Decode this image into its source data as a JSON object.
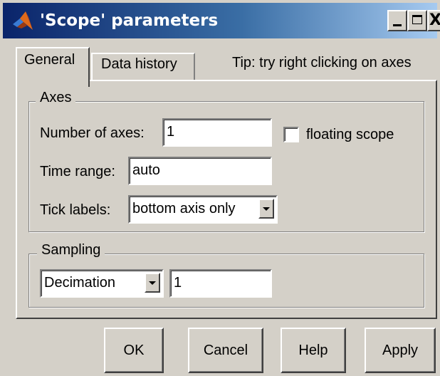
{
  "window": {
    "title": "'Scope' parameters",
    "icon": "matlab-logo-icon",
    "controls": [
      "minimize-icon",
      "maximize-icon",
      "close-icon"
    ],
    "close_glyph": "X"
  },
  "tabs": [
    {
      "label": "General",
      "selected": true
    },
    {
      "label": "Data history",
      "selected": false
    }
  ],
  "tip": "Tip: try right clicking on axes",
  "axes_group": {
    "legend": "Axes",
    "number_of_axes": {
      "label": "Number of axes:",
      "value": "1"
    },
    "floating_scope": {
      "label": "floating scope",
      "checked": false
    },
    "time_range": {
      "label": "Time range:",
      "value": "auto"
    },
    "tick_labels": {
      "label": "Tick labels:",
      "value": "bottom axis only"
    }
  },
  "sampling_group": {
    "legend": "Sampling",
    "mode": "Decimation",
    "value": "1"
  },
  "buttons": {
    "ok": "OK",
    "cancel": "Cancel",
    "help": "Help",
    "apply": "Apply"
  },
  "colors": {
    "dialog_bg": "#d4d0c8",
    "titlebar_start": "#0a246a",
    "titlebar_end": "#a6caf0",
    "title_text": "#ffffff"
  }
}
